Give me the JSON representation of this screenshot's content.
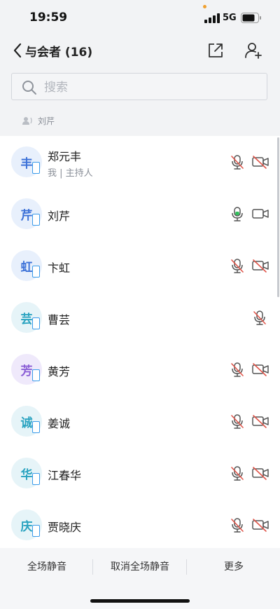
{
  "status": {
    "time": "19:59",
    "network": "5G"
  },
  "header": {
    "title": "与会者 (16)",
    "icons": [
      "back-chevron",
      "share-external",
      "add-user"
    ]
  },
  "search": {
    "placeholder": "搜索",
    "value": ""
  },
  "speaking": {
    "label": "刘芹"
  },
  "participants": [
    {
      "initial": "丰",
      "name": "郑元丰",
      "subtitle": "我 | 主持人",
      "avatar_bg": "#e8f0fc",
      "avatar_fg": "#3d72d8",
      "mic": "muted",
      "camera": "off"
    },
    {
      "initial": "芹",
      "name": "刘芹",
      "subtitle": "",
      "avatar_bg": "#e8f0fc",
      "avatar_fg": "#3d72d8",
      "mic": "speaking",
      "camera": "on"
    },
    {
      "initial": "虹",
      "name": "卞虹",
      "subtitle": "",
      "avatar_bg": "#e8f0fc",
      "avatar_fg": "#3d72d8",
      "mic": "muted",
      "camera": "off"
    },
    {
      "initial": "芸",
      "name": "曹芸",
      "subtitle": "",
      "avatar_bg": "#e6f4f8",
      "avatar_fg": "#2aa3c0",
      "mic": "muted",
      "camera": "none"
    },
    {
      "initial": "芳",
      "name": "黄芳",
      "subtitle": "",
      "avatar_bg": "#efe9fb",
      "avatar_fg": "#8b5fd6",
      "mic": "muted",
      "camera": "off"
    },
    {
      "initial": "诚",
      "name": "姜诚",
      "subtitle": "",
      "avatar_bg": "#e6f4f8",
      "avatar_fg": "#2aa3c0",
      "mic": "muted",
      "camera": "off"
    },
    {
      "initial": "华",
      "name": "江春华",
      "subtitle": "",
      "avatar_bg": "#e6f4f8",
      "avatar_fg": "#2aa3c0",
      "mic": "muted",
      "camera": "off"
    },
    {
      "initial": "庆",
      "name": "贾晓庆",
      "subtitle": "",
      "avatar_bg": "#e6f4f8",
      "avatar_fg": "#2aa3c0",
      "mic": "muted",
      "camera": "off"
    }
  ],
  "footer": {
    "mute_all": "全场静音",
    "unmute_all": "取消全场静音",
    "more": "更多"
  },
  "colors": {
    "accent": "#3a9bea",
    "muted_red": "#e0554a",
    "speaking_green": "#2fbf5a"
  }
}
